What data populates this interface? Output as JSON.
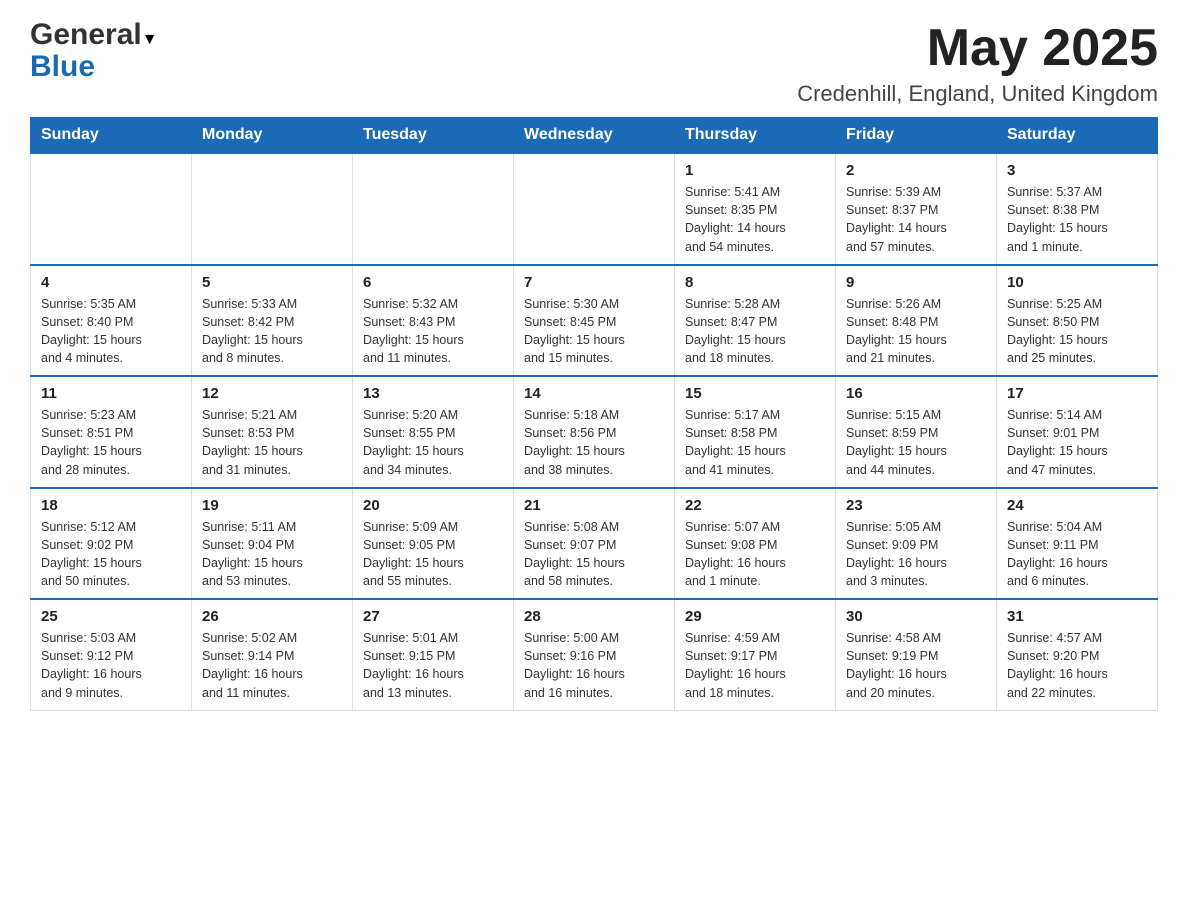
{
  "header": {
    "logo_general": "General",
    "logo_blue": "Blue",
    "month_title": "May 2025",
    "location": "Credenhill, England, United Kingdom"
  },
  "days_of_week": [
    "Sunday",
    "Monday",
    "Tuesday",
    "Wednesday",
    "Thursday",
    "Friday",
    "Saturday"
  ],
  "weeks": [
    [
      {
        "day": "",
        "info": ""
      },
      {
        "day": "",
        "info": ""
      },
      {
        "day": "",
        "info": ""
      },
      {
        "day": "",
        "info": ""
      },
      {
        "day": "1",
        "info": "Sunrise: 5:41 AM\nSunset: 8:35 PM\nDaylight: 14 hours\nand 54 minutes."
      },
      {
        "day": "2",
        "info": "Sunrise: 5:39 AM\nSunset: 8:37 PM\nDaylight: 14 hours\nand 57 minutes."
      },
      {
        "day": "3",
        "info": "Sunrise: 5:37 AM\nSunset: 8:38 PM\nDaylight: 15 hours\nand 1 minute."
      }
    ],
    [
      {
        "day": "4",
        "info": "Sunrise: 5:35 AM\nSunset: 8:40 PM\nDaylight: 15 hours\nand 4 minutes."
      },
      {
        "day": "5",
        "info": "Sunrise: 5:33 AM\nSunset: 8:42 PM\nDaylight: 15 hours\nand 8 minutes."
      },
      {
        "day": "6",
        "info": "Sunrise: 5:32 AM\nSunset: 8:43 PM\nDaylight: 15 hours\nand 11 minutes."
      },
      {
        "day": "7",
        "info": "Sunrise: 5:30 AM\nSunset: 8:45 PM\nDaylight: 15 hours\nand 15 minutes."
      },
      {
        "day": "8",
        "info": "Sunrise: 5:28 AM\nSunset: 8:47 PM\nDaylight: 15 hours\nand 18 minutes."
      },
      {
        "day": "9",
        "info": "Sunrise: 5:26 AM\nSunset: 8:48 PM\nDaylight: 15 hours\nand 21 minutes."
      },
      {
        "day": "10",
        "info": "Sunrise: 5:25 AM\nSunset: 8:50 PM\nDaylight: 15 hours\nand 25 minutes."
      }
    ],
    [
      {
        "day": "11",
        "info": "Sunrise: 5:23 AM\nSunset: 8:51 PM\nDaylight: 15 hours\nand 28 minutes."
      },
      {
        "day": "12",
        "info": "Sunrise: 5:21 AM\nSunset: 8:53 PM\nDaylight: 15 hours\nand 31 minutes."
      },
      {
        "day": "13",
        "info": "Sunrise: 5:20 AM\nSunset: 8:55 PM\nDaylight: 15 hours\nand 34 minutes."
      },
      {
        "day": "14",
        "info": "Sunrise: 5:18 AM\nSunset: 8:56 PM\nDaylight: 15 hours\nand 38 minutes."
      },
      {
        "day": "15",
        "info": "Sunrise: 5:17 AM\nSunset: 8:58 PM\nDaylight: 15 hours\nand 41 minutes."
      },
      {
        "day": "16",
        "info": "Sunrise: 5:15 AM\nSunset: 8:59 PM\nDaylight: 15 hours\nand 44 minutes."
      },
      {
        "day": "17",
        "info": "Sunrise: 5:14 AM\nSunset: 9:01 PM\nDaylight: 15 hours\nand 47 minutes."
      }
    ],
    [
      {
        "day": "18",
        "info": "Sunrise: 5:12 AM\nSunset: 9:02 PM\nDaylight: 15 hours\nand 50 minutes."
      },
      {
        "day": "19",
        "info": "Sunrise: 5:11 AM\nSunset: 9:04 PM\nDaylight: 15 hours\nand 53 minutes."
      },
      {
        "day": "20",
        "info": "Sunrise: 5:09 AM\nSunset: 9:05 PM\nDaylight: 15 hours\nand 55 minutes."
      },
      {
        "day": "21",
        "info": "Sunrise: 5:08 AM\nSunset: 9:07 PM\nDaylight: 15 hours\nand 58 minutes."
      },
      {
        "day": "22",
        "info": "Sunrise: 5:07 AM\nSunset: 9:08 PM\nDaylight: 16 hours\nand 1 minute."
      },
      {
        "day": "23",
        "info": "Sunrise: 5:05 AM\nSunset: 9:09 PM\nDaylight: 16 hours\nand 3 minutes."
      },
      {
        "day": "24",
        "info": "Sunrise: 5:04 AM\nSunset: 9:11 PM\nDaylight: 16 hours\nand 6 minutes."
      }
    ],
    [
      {
        "day": "25",
        "info": "Sunrise: 5:03 AM\nSunset: 9:12 PM\nDaylight: 16 hours\nand 9 minutes."
      },
      {
        "day": "26",
        "info": "Sunrise: 5:02 AM\nSunset: 9:14 PM\nDaylight: 16 hours\nand 11 minutes."
      },
      {
        "day": "27",
        "info": "Sunrise: 5:01 AM\nSunset: 9:15 PM\nDaylight: 16 hours\nand 13 minutes."
      },
      {
        "day": "28",
        "info": "Sunrise: 5:00 AM\nSunset: 9:16 PM\nDaylight: 16 hours\nand 16 minutes."
      },
      {
        "day": "29",
        "info": "Sunrise: 4:59 AM\nSunset: 9:17 PM\nDaylight: 16 hours\nand 18 minutes."
      },
      {
        "day": "30",
        "info": "Sunrise: 4:58 AM\nSunset: 9:19 PM\nDaylight: 16 hours\nand 20 minutes."
      },
      {
        "day": "31",
        "info": "Sunrise: 4:57 AM\nSunset: 9:20 PM\nDaylight: 16 hours\nand 22 minutes."
      }
    ]
  ]
}
